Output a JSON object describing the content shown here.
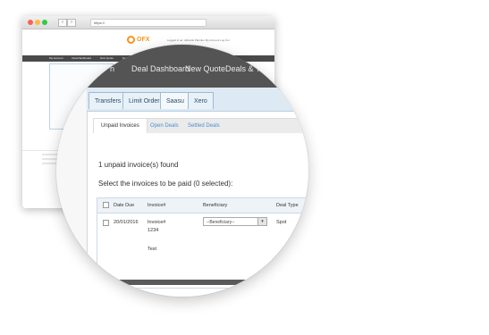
{
  "browser": {
    "address": "https://",
    "back_glyph": "‹",
    "forward_glyph": "›",
    "logo_text": "OFX",
    "header_links": "Logged in as: Jahnelle Palmiter    My Account    Log Out",
    "nav_items": [
      "My Account",
      "Deal Dashboard",
      "New Quote",
      "Deals & Transfers",
      "Reports",
      "Settings"
    ]
  },
  "zoomed": {
    "top_menu": [
      "n",
      "Deal Dashboard",
      "New Quote",
      "Deals & T"
    ],
    "tabs": [
      "Transfers",
      "Limit Orders",
      "Saasu",
      "Xero"
    ],
    "active_tab": "Saasu",
    "subtabs": [
      "Unpaid Invoices",
      "Open Deals",
      "Settled Deals"
    ],
    "unpaid_count_text": "1 unpaid invoice(s) found",
    "select_text": "Select the invoices to be paid (0 selected):",
    "table": {
      "headers": [
        "Date Due",
        "Invoice#",
        "Beneficiary",
        "Deal Type"
      ],
      "rows": [
        {
          "date_due": "20/01/2016",
          "invoice_line1": "Invoice#",
          "invoice_line2": "1234",
          "invoice_line3": "Test",
          "beneficiary": "--Beneficiary--",
          "deal_type": "Spot"
        }
      ]
    }
  },
  "colors": {
    "accent": "#f7941d",
    "menu_bar": "#545454",
    "tab_border": "#9fbbd3",
    "link": "#4a8fd1"
  }
}
